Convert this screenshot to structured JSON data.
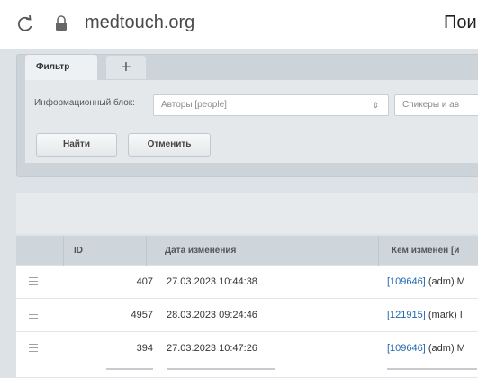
{
  "browser": {
    "url": "medtouch.org",
    "page_title_fragment": "Пои"
  },
  "filter": {
    "tab_label": "Фильтр",
    "add_tab_label": "+",
    "field_label": "Информационный блок:",
    "select_value": "Авторы [people]",
    "second_select_value": "Спикеры и ав",
    "find_button": "Найти",
    "cancel_button": "Отменить"
  },
  "grid": {
    "columns": [
      "ID",
      "Дата изменения",
      "Кем изменен [и"
    ],
    "rows": [
      {
        "id": "407",
        "date": "27.03.2023 10:44:38",
        "user_link": "[109646]",
        "user_rest": " (adm) M"
      },
      {
        "id": "4957",
        "date": "28.03.2023 09:24:46",
        "user_link": "[121915]",
        "user_rest": " (mark) I"
      },
      {
        "id": "394",
        "date": "27.03.2023 10:47:26",
        "user_link": "[109646]",
        "user_rest": " (adm) M"
      }
    ]
  },
  "icons": {
    "reload": "reload-icon",
    "lock": "lock-icon",
    "row_menu": "row-menu-icon",
    "select_arrow": "updown-arrow-icon"
  },
  "colors": {
    "link": "#2067b0",
    "panel": "#cdd4d9",
    "header": "#cfd6db"
  }
}
